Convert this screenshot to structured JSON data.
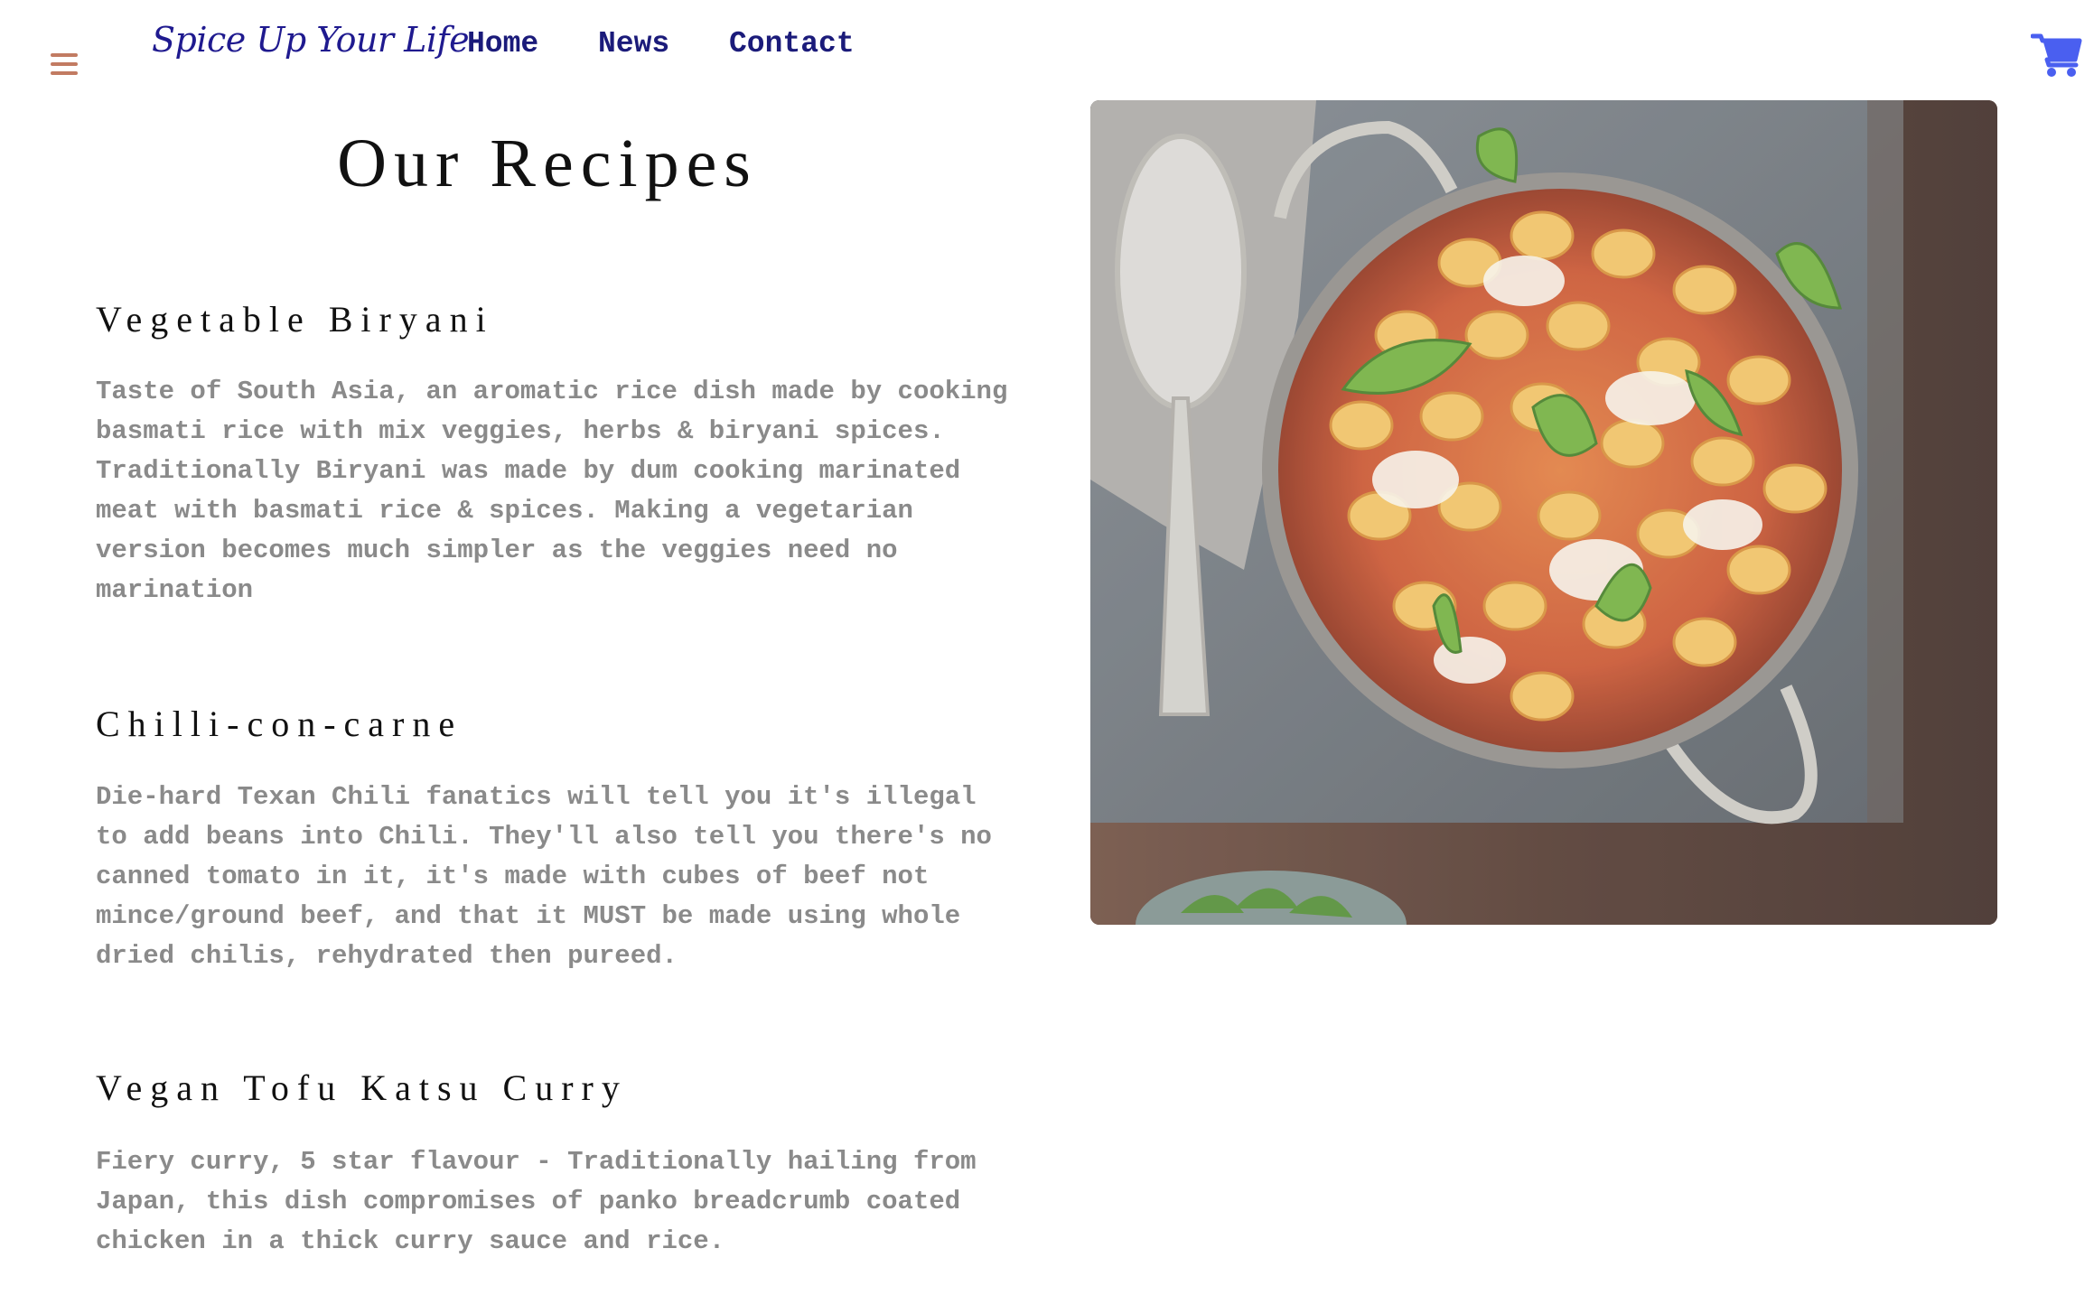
{
  "header": {
    "brand": "Spice Up Your Life",
    "nav": [
      {
        "label": "Home"
      },
      {
        "label": "News"
      },
      {
        "label": "Contact"
      }
    ],
    "menu_icon": "hamburger-icon",
    "cart_icon": "shopping-cart-icon"
  },
  "main": {
    "title": "Our Recipes",
    "recipes": [
      {
        "title": "Vegetable Biryani",
        "description": "Taste of South Asia, an aromatic rice dish made by cooking basmati rice with mix veggies, herbs & biryani spices. Traditionally Biryani was made by dum cooking marinated meat with basmati rice & spices. Making a vegetarian version becomes much simpler as the veggies need no marination"
      },
      {
        "title": "Chilli-con-carne",
        "description": "Die-hard Texan Chili fanatics will tell you it's illegal to add beans into Chili. They'll also tell you there's no canned tomato in it, it's made with cubes of beef not mince/ground beef, and that it MUST be made using whole dried chilis, rehydrated then pureed."
      },
      {
        "title": "Vegan Tofu Katsu Curry",
        "description": "Fiery curry, 5 star flavour - Traditionally hailing from Japan, this dish compromises of panko breadcrumb coated chicken in a thick curry sauce and rice."
      }
    ]
  },
  "colors": {
    "menu_icon": "#c27b62",
    "brand": "#1f1a8f",
    "nav": "#1b1b7a",
    "cart": "#4a5ff0",
    "body_text": "#8a8a8a",
    "heading": "#111111"
  }
}
